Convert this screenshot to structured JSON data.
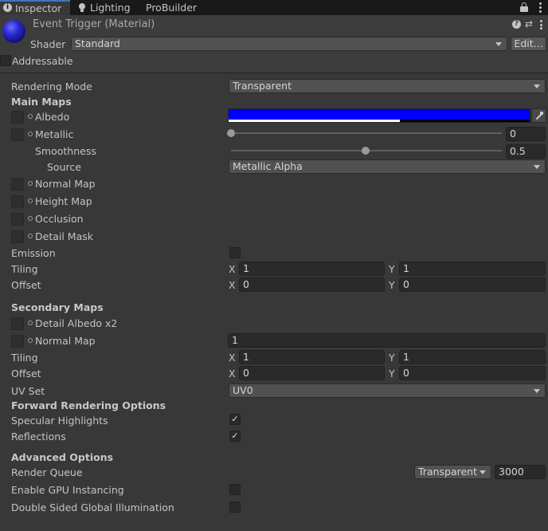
{
  "tabs": [
    {
      "label": "Inspector",
      "icon": "info-icon",
      "active": true
    },
    {
      "label": "Lighting",
      "icon": "lightbulb-icon",
      "active": false
    },
    {
      "label": "ProBuilder",
      "icon": "",
      "active": false
    }
  ],
  "header": {
    "title": "Event Trigger (Material)",
    "shader_label": "Shader",
    "shader_value": "Standard",
    "edit_button": "Edit...",
    "addressable_label": "Addressable"
  },
  "rendering_mode": {
    "label": "Rendering Mode",
    "value": "Transparent"
  },
  "main_maps": {
    "heading": "Main Maps",
    "albedo": {
      "label": "Albedo",
      "color": "#0000ff",
      "alpha_fraction": 0.57
    },
    "metallic": {
      "label": "Metallic",
      "value": "0",
      "slider_fraction": 0.0
    },
    "smoothness": {
      "label": "Smoothness",
      "value": "0.5",
      "slider_fraction": 0.5
    },
    "source": {
      "label": "Source",
      "value": "Metallic Alpha"
    },
    "normal_map": "Normal Map",
    "height_map": "Height Map",
    "occlusion": "Occlusion",
    "detail_mask": "Detail Mask",
    "emission": "Emission",
    "tiling": {
      "label": "Tiling",
      "x": "1",
      "y": "1"
    },
    "offset": {
      "label": "Offset",
      "x": "0",
      "y": "0"
    }
  },
  "secondary_maps": {
    "heading": "Secondary Maps",
    "detail_albedo": "Detail Albedo x2",
    "normal_map": {
      "label": "Normal Map",
      "value": "1"
    },
    "tiling": {
      "label": "Tiling",
      "x": "1",
      "y": "1"
    },
    "offset": {
      "label": "Offset",
      "x": "0",
      "y": "0"
    },
    "uv_set": {
      "label": "UV Set",
      "value": "UV0"
    }
  },
  "forward_rendering": {
    "heading": "Forward Rendering Options",
    "specular": {
      "label": "Specular Highlights",
      "checked": true
    },
    "reflections": {
      "label": "Reflections",
      "checked": true
    }
  },
  "advanced": {
    "heading": "Advanced Options",
    "render_queue": {
      "label": "Render Queue",
      "mode": "Transparent",
      "value": "3000"
    },
    "gpu_instancing": {
      "label": "Enable GPU Instancing",
      "checked": false
    },
    "double_sided_gi": {
      "label": "Double Sided Global Illumination",
      "checked": false
    }
  },
  "axis": {
    "x": "X",
    "y": "Y"
  },
  "check_glyph": "✓"
}
